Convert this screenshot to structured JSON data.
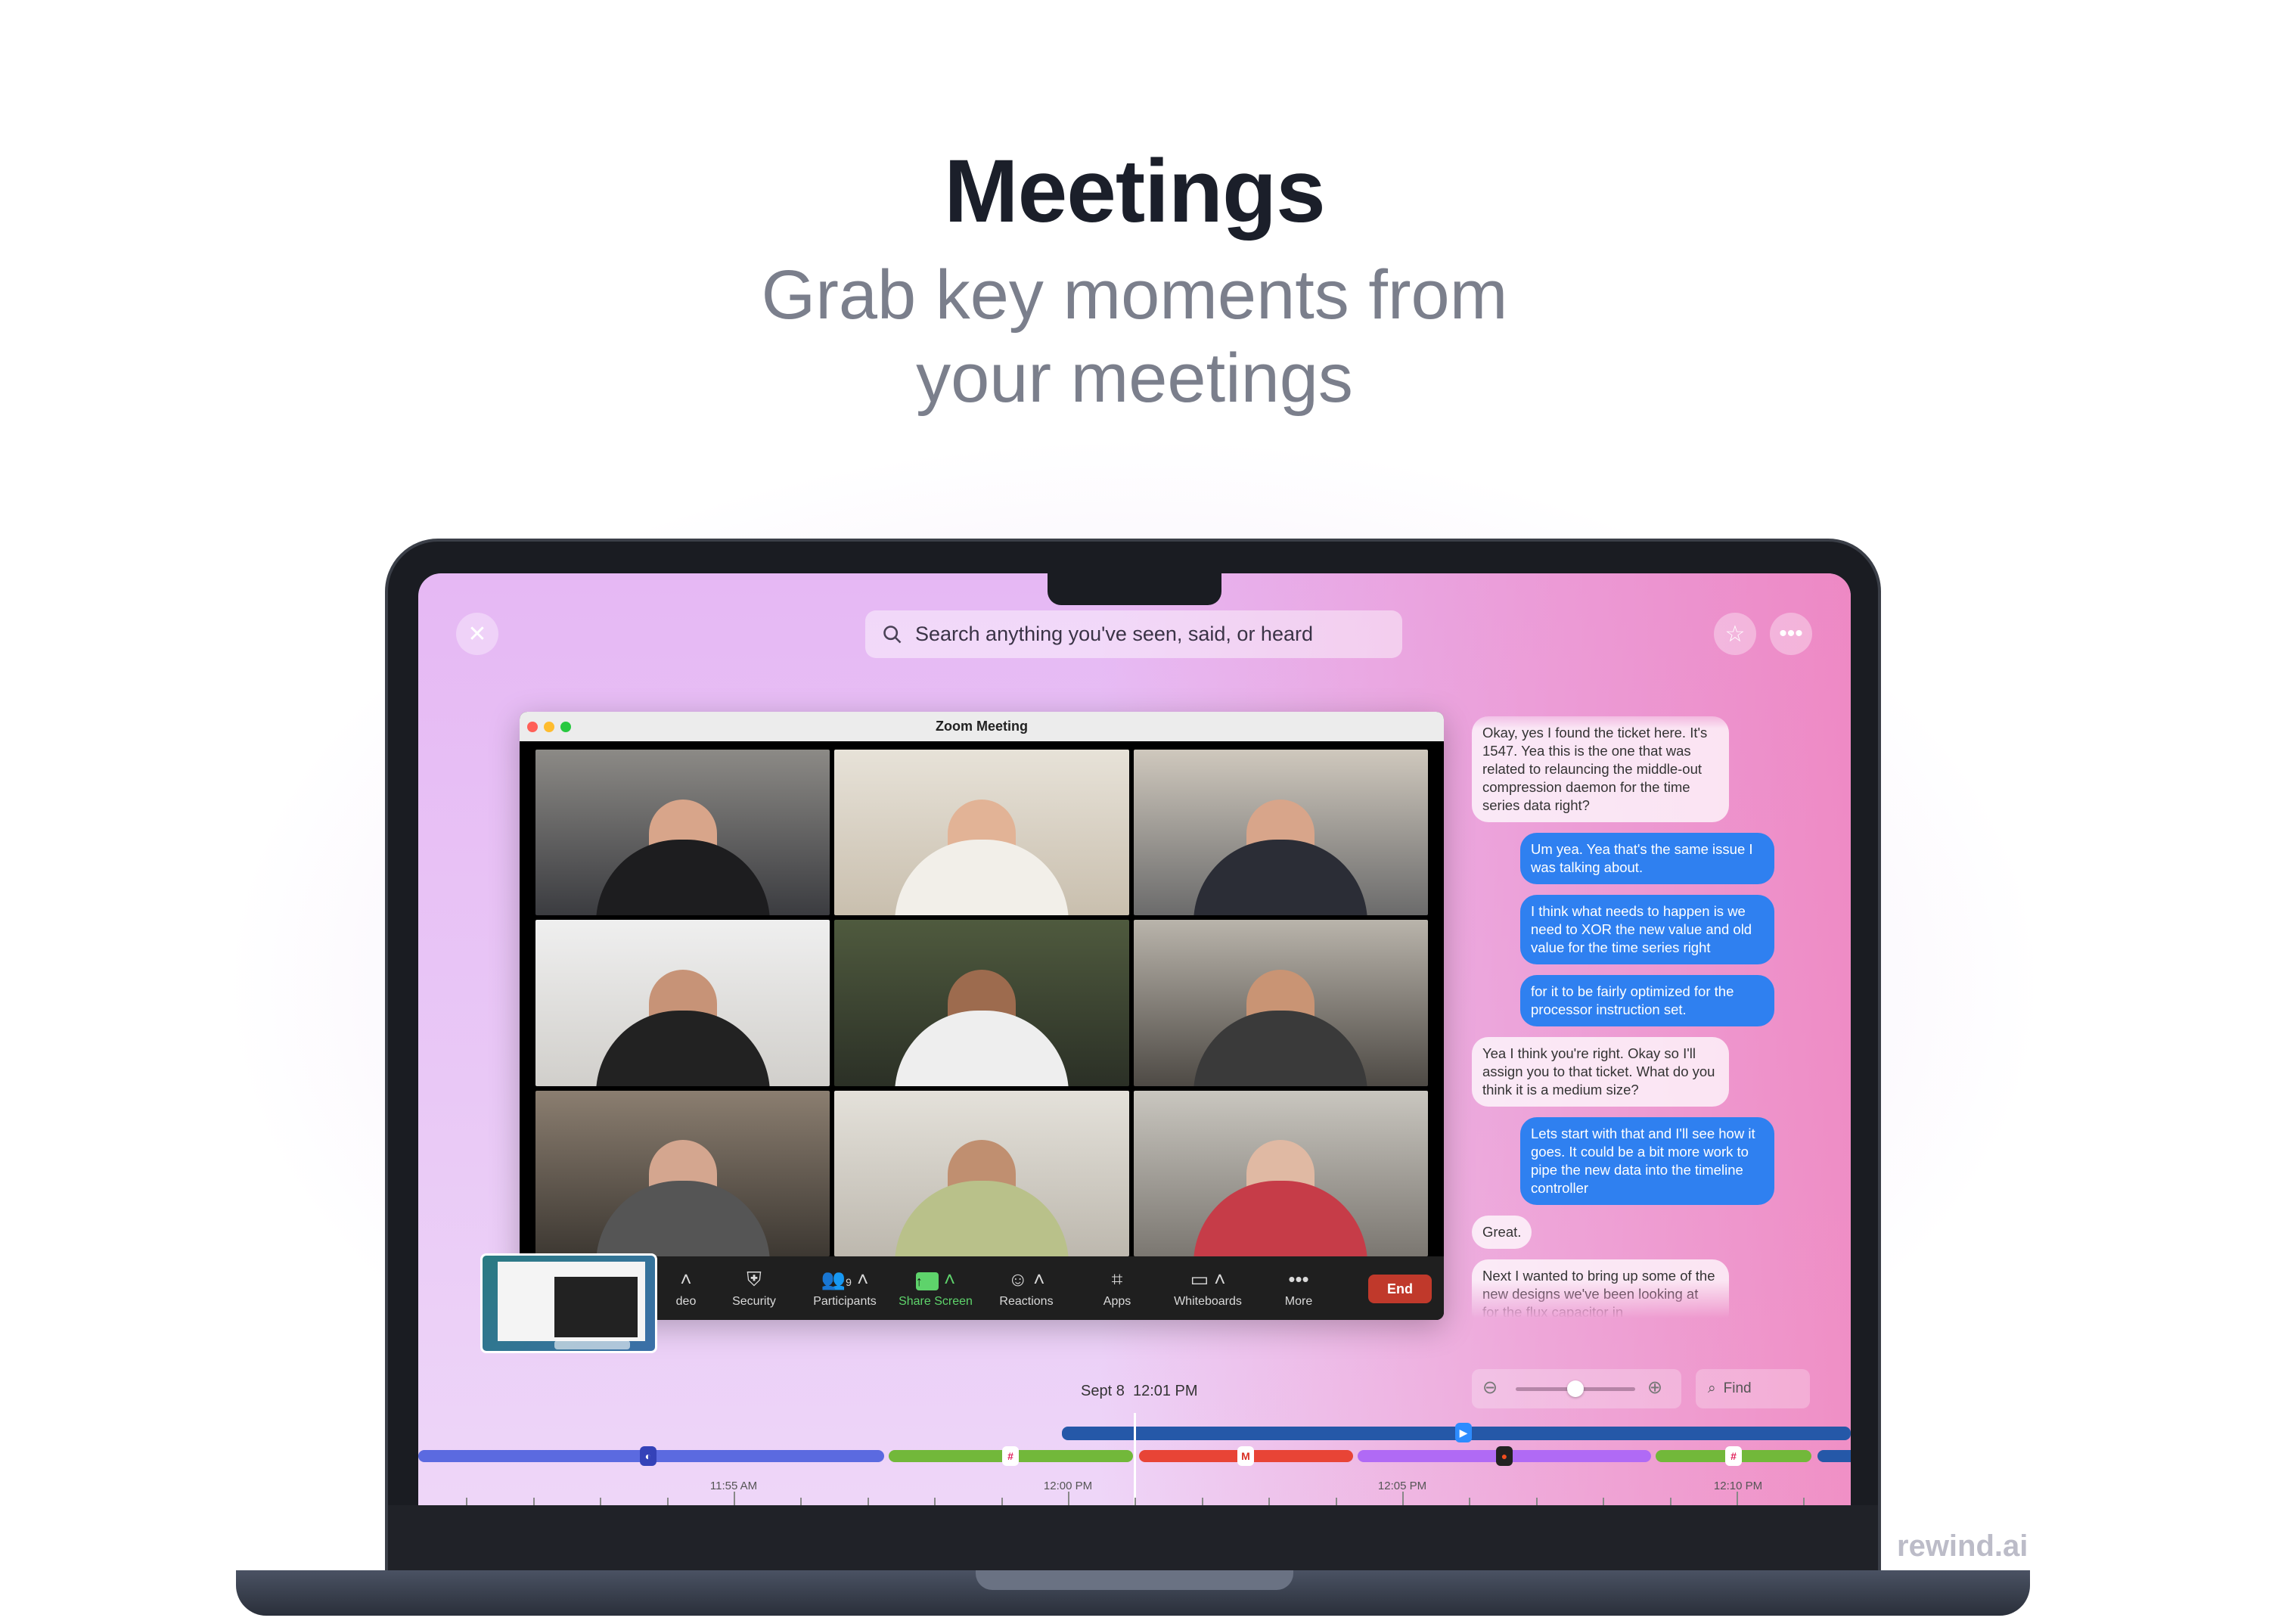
{
  "hero": {
    "title": "Meetings",
    "subtitle_line1": "Grab key moments from",
    "subtitle_line2": "your meetings"
  },
  "app": {
    "search_placeholder": "Search anything you've seen, said, or heard",
    "close_icon": "close-icon",
    "star_icon": "star-icon",
    "more_icon": "more-icon"
  },
  "zoom_window": {
    "title": "Zoom Meeting",
    "participants_count": "9",
    "toolbar": [
      {
        "label": "deo",
        "icon": "video-icon"
      },
      {
        "label": "Security",
        "icon": "shield-icon"
      },
      {
        "label": "Participants",
        "icon": "participants-icon"
      },
      {
        "label": "Share Screen",
        "icon": "share-screen-icon"
      },
      {
        "label": "Reactions",
        "icon": "reactions-icon"
      },
      {
        "label": "Apps",
        "icon": "apps-icon"
      },
      {
        "label": "Whiteboards",
        "icon": "whiteboard-icon"
      },
      {
        "label": "More",
        "icon": "more-icon"
      }
    ],
    "end_label": "End",
    "share_color": "#5ed36b",
    "end_color": "#c0392b"
  },
  "transcript": [
    {
      "from": "them",
      "text": "Okay, yes I found the ticket here. It's 1547. Yea this is the one that was related to relauncing the middle-out compression daemon for the time series data right?"
    },
    {
      "from": "me",
      "text": "Um yea. Yea that's the same issue I was talking about."
    },
    {
      "from": "me",
      "text": "I think what needs to happen is we need to XOR the new value and old value for the time series right"
    },
    {
      "from": "me",
      "text": "for it to be fairly optimized for the processor instruction set."
    },
    {
      "from": "them",
      "text": "Yea I think you're right. Okay so I'll assign you to that ticket. What do you think it is a medium size?"
    },
    {
      "from": "me",
      "text": "Lets start with that and I'll see how it goes. It could be a bit more work to pipe the new data into the timeline controller"
    },
    {
      "from": "them",
      "text": "Great."
    },
    {
      "from": "them",
      "text": "Next I wanted to bring up some of the new designs we've been looking at for the flux capacitor in"
    }
  ],
  "timeline": {
    "date": "Sept 8",
    "time": "12:01 PM",
    "find_label": "Find",
    "zoom_level": 0.5,
    "time_labels": [
      "11:55 AM",
      "12:00 PM",
      "12:05 PM",
      "12:10 PM"
    ],
    "apps": [
      "linear",
      "slack",
      "gmail",
      "figma",
      "slack",
      "zoom"
    ]
  },
  "watermark": "rewind.ai"
}
